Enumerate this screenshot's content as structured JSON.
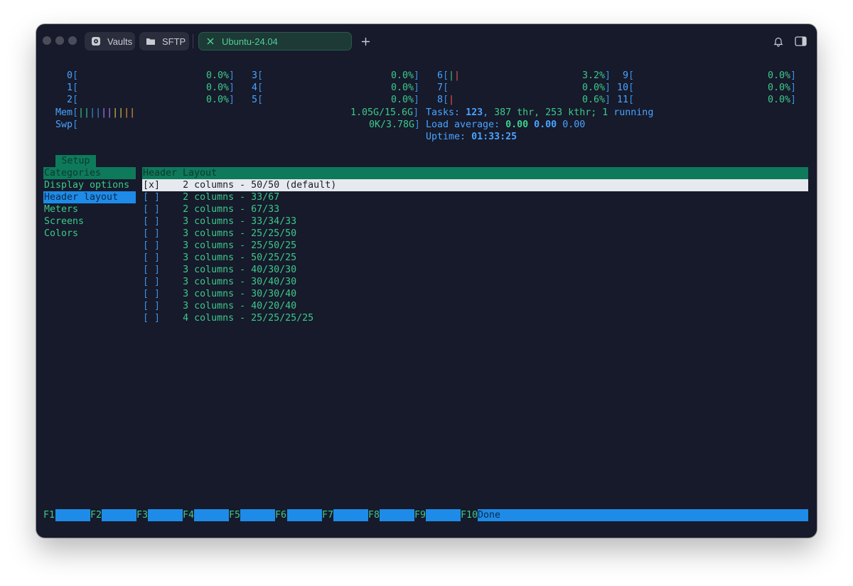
{
  "titlebar": {
    "tabs": [
      {
        "label": "Vaults",
        "icon": "vault-icon"
      },
      {
        "label": "SFTP",
        "icon": "folder-icon"
      },
      {
        "label": "Ubuntu-24.04",
        "icon": "close-icon",
        "active": true
      }
    ],
    "colors": {
      "window_bg": "#161a2b",
      "active_tab": "#1d3a36",
      "accent_green": "#3dc98a",
      "accent_blue": "#1f8be8"
    }
  },
  "cpus": [
    {
      "id": "0",
      "value": "0.0%"
    },
    {
      "id": "1",
      "value": "0.0%"
    },
    {
      "id": "2",
      "value": "0.0%"
    },
    {
      "id": "3",
      "value": "0.0%"
    },
    {
      "id": "4",
      "value": "0.0%"
    },
    {
      "id": "5",
      "value": "0.0%"
    },
    {
      "id": "6",
      "value": "3.2%"
    },
    {
      "id": "7",
      "value": "0.0%"
    },
    {
      "id": "8",
      "value": "0.6%"
    },
    {
      "id": "9",
      "value": "0.0%"
    },
    {
      "id": "10",
      "value": "0.0%"
    },
    {
      "id": "11",
      "value": "0.0%"
    }
  ],
  "mem": {
    "label": "Mem",
    "value": "1.05G/15.6G"
  },
  "swp": {
    "label": "Swp",
    "value": "0K/3.78G"
  },
  "tasks": {
    "label": "Tasks:",
    "count": "123",
    "thr": "387 thr,",
    "kthr": "253 kthr;",
    "running_n": "1",
    "running_label": "running"
  },
  "load": {
    "label": "Load average:",
    "v1": "0.00",
    "v2": "0.00",
    "v3": "0.00"
  },
  "uptime": {
    "label": "Uptime:",
    "value": "01:33:25"
  },
  "setup": {
    "tab_label": "Setup",
    "categories_header": "Categories",
    "categories": [
      "Display options",
      "Header layout",
      "Meters",
      "Screens",
      "Colors"
    ],
    "selected_category": 1,
    "panel_header": "Header Layout",
    "options": [
      {
        "box": "[x]",
        "label": "2 columns - 50/50 (default)"
      },
      {
        "box": "[ ]",
        "label": "2 columns - 33/67"
      },
      {
        "box": "[ ]",
        "label": "2 columns - 67/33"
      },
      {
        "box": "[ ]",
        "label": "3 columns - 33/34/33"
      },
      {
        "box": "[ ]",
        "label": "3 columns - 25/25/50"
      },
      {
        "box": "[ ]",
        "label": "3 columns - 25/50/25"
      },
      {
        "box": "[ ]",
        "label": "3 columns - 50/25/25"
      },
      {
        "box": "[ ]",
        "label": "3 columns - 40/30/30"
      },
      {
        "box": "[ ]",
        "label": "3 columns - 30/40/30"
      },
      {
        "box": "[ ]",
        "label": "3 columns - 30/30/40"
      },
      {
        "box": "[ ]",
        "label": "3 columns - 40/20/40"
      },
      {
        "box": "[ ]",
        "label": "4 columns - 25/25/25/25"
      }
    ],
    "selected_option": 0
  },
  "fkeys": [
    {
      "key": "F1",
      "label": ""
    },
    {
      "key": "F2",
      "label": ""
    },
    {
      "key": "F3",
      "label": ""
    },
    {
      "key": "F4",
      "label": ""
    },
    {
      "key": "F5",
      "label": ""
    },
    {
      "key": "F6",
      "label": ""
    },
    {
      "key": "F7",
      "label": ""
    },
    {
      "key": "F8",
      "label": ""
    },
    {
      "key": "F9",
      "label": ""
    },
    {
      "key": "F10",
      "label": "Done"
    }
  ]
}
